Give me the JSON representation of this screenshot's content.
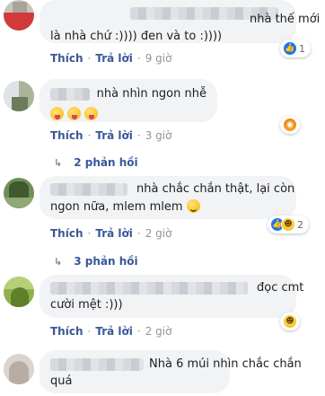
{
  "comments": [
    {
      "text": "nhà thế mới\nlà nhà chứ :)))) đen và to :))))",
      "reaction": {
        "icon": "like-reaction-icon",
        "count": "1"
      },
      "actions": {
        "like": "Thích",
        "reply": "Trả lời",
        "time": "9 giờ"
      }
    },
    {
      "text": "nhà nhìn ngon nhễ",
      "emojis": [
        "tongue-out-emoji",
        "tongue-out-emoji",
        "tongue-out-emoji"
      ],
      "reaction": {
        "icon": "angry-reaction-icon"
      },
      "actions": {
        "like": "Thích",
        "reply": "Trả lời",
        "time": "3 giờ"
      },
      "replies": {
        "label": "2 phản hồi"
      }
    },
    {
      "text_line1": "nhà chắc chắn thật, lại còn",
      "text_line2": "ngon nữa, mlem mlem",
      "emoji": "winking-tongue-emoji",
      "reaction": {
        "icons": [
          "like-reaction-icon",
          "haha-reaction-icon"
        ],
        "count": "2"
      },
      "actions": {
        "like": "Thích",
        "reply": "Trả lời",
        "time": "2 giờ"
      },
      "replies": {
        "label": "3 phản hồi"
      }
    },
    {
      "text_line1": "đọc cmt",
      "text_line2": "cười mệt :)))",
      "reaction": {
        "icon": "haha-reaction-icon"
      },
      "actions": {
        "like": "Thích",
        "reply": "Trả lời",
        "time": "2 giờ"
      }
    },
    {
      "text_line1": "Nhà 6 múi nhìn chắc chắn",
      "text_line2": "quá"
    }
  ]
}
